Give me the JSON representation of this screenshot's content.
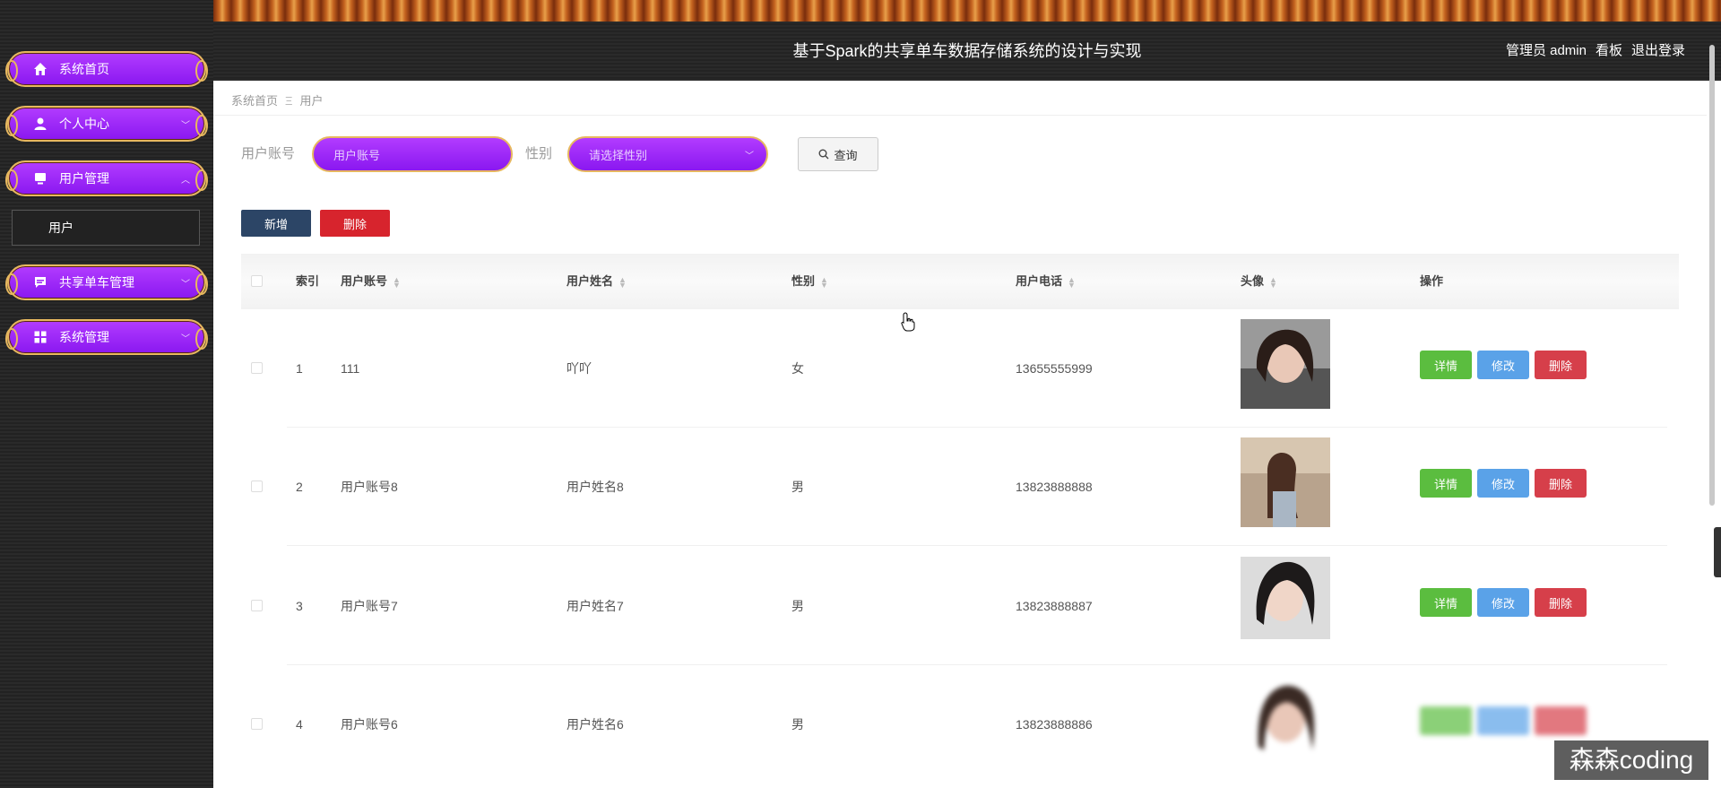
{
  "header": {
    "title": "基于Spark的共享单车数据存储系统的设计与实现",
    "admin_label": "管理员 admin",
    "board_label": "看板",
    "logout_label": "退出登录"
  },
  "sidebar": {
    "items": [
      {
        "label": "系统首页",
        "icon": "home-icon"
      },
      {
        "label": "个人中心",
        "icon": "user-icon"
      },
      {
        "label": "用户管理",
        "icon": "monitor-icon"
      },
      {
        "label": "共享单车管理",
        "icon": "chat-icon"
      },
      {
        "label": "系统管理",
        "icon": "grid-icon"
      }
    ],
    "sub_item": "用户"
  },
  "breadcrumb": {
    "home": "系统首页",
    "separator": "Ξ",
    "current": "用户"
  },
  "search": {
    "account_label": "用户账号",
    "account_placeholder": "用户账号",
    "gender_label": "性别",
    "gender_placeholder": "请选择性别",
    "query_label": "查询"
  },
  "actions": {
    "add_label": "新增",
    "delete_label": "删除"
  },
  "table": {
    "columns": [
      "索引",
      "用户账号",
      "用户姓名",
      "性别",
      "用户电话",
      "头像",
      "操作"
    ],
    "rows": [
      {
        "index": "1",
        "account": "111",
        "name": "吖吖",
        "gender": "女",
        "phone": "13655555999"
      },
      {
        "index": "2",
        "account": "用户账号8",
        "name": "用户姓名8",
        "gender": "男",
        "phone": "13823888888"
      },
      {
        "index": "3",
        "account": "用户账号7",
        "name": "用户姓名7",
        "gender": "男",
        "phone": "13823888887"
      },
      {
        "index": "4",
        "account": "用户账号6",
        "name": "用户姓名6",
        "gender": "男",
        "phone": "13823888886"
      }
    ],
    "op_labels": {
      "detail": "详情",
      "edit": "修改",
      "delete": "删除"
    }
  },
  "watermark": "森森coding",
  "colors": {
    "menu_purple": "#9b24f7",
    "menu_border": "#e7b85f",
    "add_button": "#2c4566",
    "delete_button": "#d7242d",
    "detail_button": "#5bbd3f",
    "edit_button": "#5aa2e8"
  }
}
